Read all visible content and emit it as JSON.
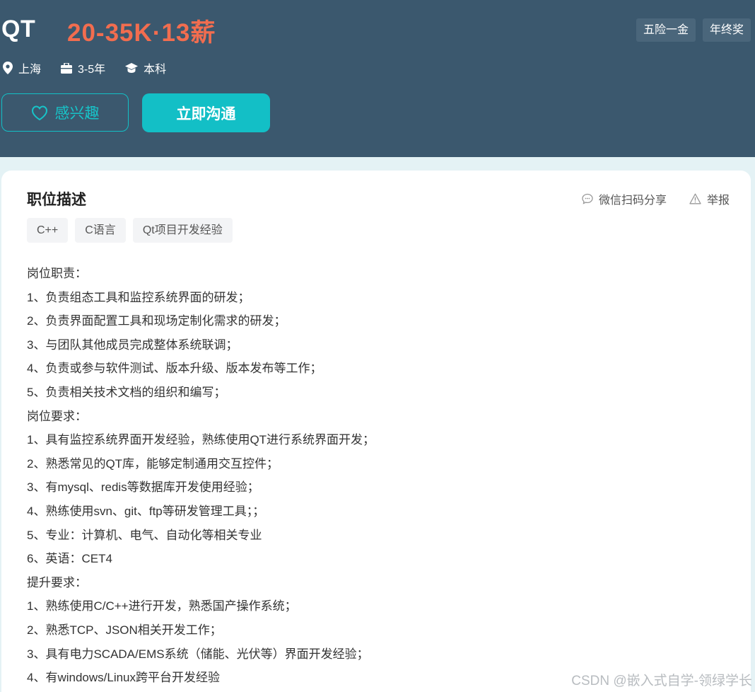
{
  "header": {
    "job_title": "QT",
    "salary": "20-35K·13薪",
    "benefits": [
      "五险一金",
      "年终奖"
    ],
    "meta": {
      "location": "上海",
      "experience": "3-5年",
      "education": "本科"
    },
    "interest_label": "感兴趣",
    "chat_label": "立即沟通"
  },
  "card": {
    "title": "职位描述",
    "share_label": "微信扫码分享",
    "report_label": "举报",
    "skills": [
      "C++",
      "C语言",
      "Qt项目开发经验"
    ],
    "description": [
      "岗位职责：",
      "1、负责组态工具和监控系统界面的研发；",
      "2、负责界面配置工具和现场定制化需求的研发；",
      "3、与团队其他成员完成整体系统联调；",
      "4、负责或参与软件测试、版本升级、版本发布等工作；",
      "5、负责相关技术文档的组织和编写；",
      "岗位要求：",
      "1、具有监控系统界面开发经验，熟练使用QT进行系统界面开发；",
      "2、熟悉常见的QT库，能够定制通用交互控件；",
      "3、有mysql、redis等数据库开发使用经验；",
      "4、熟练使用svn、git、ftp等研发管理工具；；",
      "5、专业：计算机、电气、自动化等相关专业",
      "6、英语：CET4",
      "提升要求：",
      "1、熟练使用C/C++进行开发，熟悉国产操作系统；",
      "2、熟悉TCP、JSON相关开发工作；",
      "3、具有电力SCADA/EMS系统（储能、光伏等）界面开发经验；",
      "4、有windows/Linux跨平台开发经验"
    ]
  },
  "watermark": "CSDN @嵌入式自学-领绿学长",
  "colors": {
    "header_bg": "#3b586e",
    "salary": "#f26d4f",
    "accent": "#13bfc6",
    "page_bg": "#e4f2f5"
  }
}
